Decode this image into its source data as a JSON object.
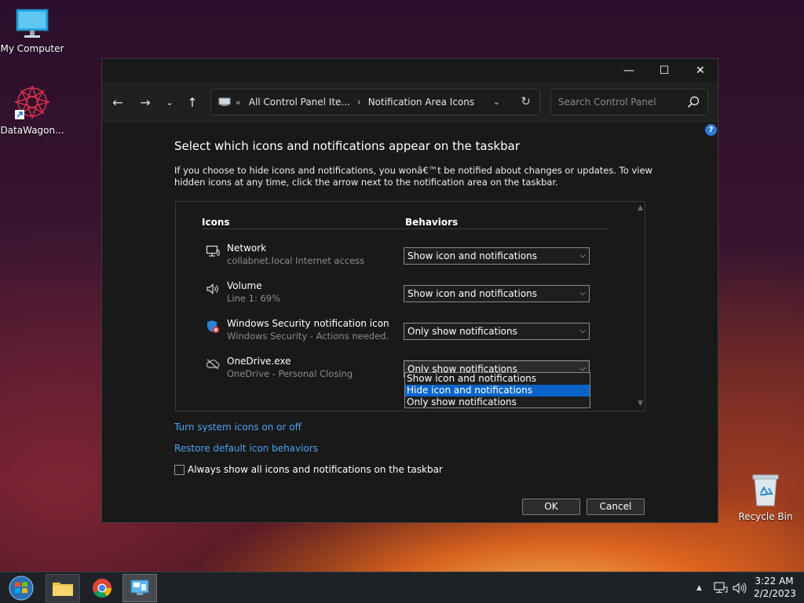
{
  "desktop": {
    "icons": [
      {
        "label": "My Computer"
      },
      {
        "label": "DataWagon..."
      },
      {
        "label": "Recycle Bin"
      }
    ]
  },
  "window": {
    "controls": {
      "minimize": "—",
      "maximize": "☐",
      "close": "✕"
    },
    "address": {
      "chevron": "«",
      "part1": "All Control Panel Ite...",
      "separator": "›",
      "part2": "Notification Area Icons"
    },
    "search": {
      "placeholder": "Search Control Panel"
    },
    "help": "?"
  },
  "content": {
    "heading": "Select which icons and notifications appear on the taskbar",
    "description": "If you choose to hide icons and notifications, you wonâ€™t be notified about changes or updates. To view hidden icons at any time, click the arrow next to the notification area on the taskbar.",
    "columns": {
      "icons": "Icons",
      "behaviors": "Behaviors"
    },
    "rows": [
      {
        "name": "Network",
        "sub": "collabnet.local Internet access",
        "behavior": "Show icon and notifications",
        "icon": "network-monitor-icon"
      },
      {
        "name": "Volume",
        "sub": "Line 1: 69%",
        "behavior": "Show icon and notifications",
        "icon": "speaker-icon"
      },
      {
        "name": "Windows Security notification icon",
        "sub": "Windows Security - Actions needed.",
        "behavior": "Only show notifications",
        "icon": "shield-warning-icon"
      },
      {
        "name": "OneDrive.exe",
        "sub": "OneDrive - Personal Closing",
        "behavior": "Only show notifications",
        "icon": "cloud-off-icon"
      }
    ],
    "dropdown_options": [
      "Show icon and notifications",
      "Hide icon and notifications",
      "Only show notifications"
    ],
    "highlighted_option_index": 1,
    "links": {
      "system_icons": "Turn system icons on or off",
      "restore": "Restore default icon behaviors"
    },
    "always_show": {
      "label": "Always show all icons and notifications on the taskbar",
      "checked": false
    },
    "buttons": {
      "ok": "OK",
      "cancel": "Cancel"
    }
  },
  "taskbar": {
    "clock": {
      "time": "3:22 AM",
      "date": "2/2/2023"
    }
  },
  "colors": {
    "accent": "#0a64c8",
    "link": "#4ea1f5",
    "window_bg": "#191919"
  }
}
